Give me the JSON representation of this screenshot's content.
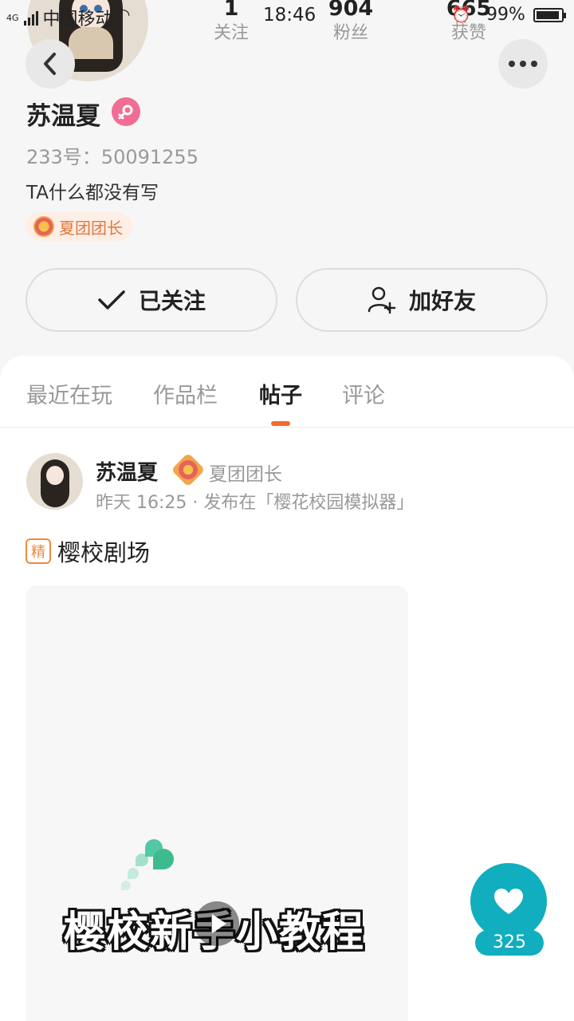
{
  "status_bar": {
    "network": "4G",
    "carrier": "中国移动",
    "time": "18:46",
    "battery": "99%"
  },
  "profile": {
    "stats": [
      {
        "value": "1",
        "label": "关注"
      },
      {
        "value": "904",
        "label": "粉丝"
      },
      {
        "value": "665",
        "label": "获赞"
      }
    ],
    "name": "苏温夏",
    "gender": "female",
    "uid": "233号：50091255",
    "bio": "TA什么都没有写",
    "badge": "夏团团长",
    "follow_button": "已关注",
    "add_friend_button": "加好友"
  },
  "tabs": [
    "最近在玩",
    "作品栏",
    "帖子",
    "评论"
  ],
  "active_tab": "帖子",
  "post": {
    "author": "苏温夏",
    "rank": "夏团团长",
    "meta": "昨天 16:25 · 发布在「樱花校园模拟器」",
    "essence_label": "精",
    "title": "樱校剧场",
    "video_caption": "樱校新手小教程"
  },
  "like": {
    "count": "325"
  },
  "colors": {
    "accent": "#f46a2a",
    "like": "#10aebe",
    "gender": "#f06d93",
    "badge": "#e0783e"
  },
  "icons": [
    "back-arrow-icon",
    "more-dots-icon",
    "female-icon",
    "medal-icon",
    "check-icon",
    "add-friend-icon",
    "play-icon",
    "heart-icon"
  ]
}
